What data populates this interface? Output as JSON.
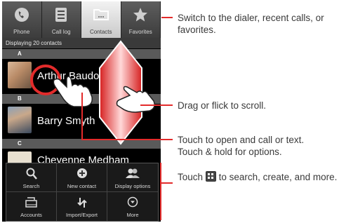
{
  "tabs": [
    {
      "label": "Phone",
      "icon": "phone-icon"
    },
    {
      "label": "Call log",
      "icon": "call-log-icon"
    },
    {
      "label": "Contacts",
      "icon": "contacts-folder-icon"
    },
    {
      "label": "Favorites",
      "icon": "star-icon"
    }
  ],
  "contacts_count": "Displaying 20 contacts",
  "sections": [
    "A",
    "B",
    "C"
  ],
  "contacts": [
    {
      "name": "Arthur Baudo"
    },
    {
      "name": "Barry Smyth"
    },
    {
      "name": "Cheyenne Medham"
    }
  ],
  "menu": [
    {
      "label": "Search",
      "icon": "magnifier-icon"
    },
    {
      "label": "New contact",
      "icon": "plus-icon"
    },
    {
      "label": "Display options",
      "icon": "people-icon"
    },
    {
      "label": "Accounts",
      "icon": "accounts-icon"
    },
    {
      "label": "Import/Export",
      "icon": "import-export-icon"
    },
    {
      "label": "More",
      "icon": "more-icon"
    }
  ],
  "callouts": {
    "switch": "Switch to the dialer, recent calls, or favorites.",
    "scroll": "Drag or flick to scroll.",
    "touch_line1": "Touch to open and call or text.",
    "touch_line2": "Touch & hold for options.",
    "menu_pre": "Touch",
    "menu_post": "to search, create, and more."
  },
  "colors": {
    "accent": "#e32b2b",
    "callout_text": "#3a3a3a"
  }
}
